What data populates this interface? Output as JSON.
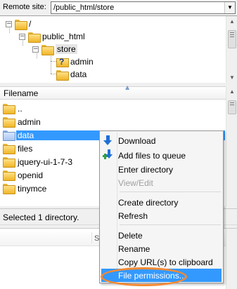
{
  "site_bar": {
    "label": "Remote site:",
    "path": "/public_html/store",
    "dropdown_icon": "chevron-down-icon"
  },
  "tree": {
    "nodes": [
      {
        "label": "/",
        "expander": "−"
      },
      {
        "label": "public_html",
        "expander": "−"
      },
      {
        "label": "store",
        "expander": "−"
      },
      {
        "label": "admin"
      },
      {
        "label": "data"
      }
    ]
  },
  "file_list": {
    "column_header": "Filename",
    "items": [
      {
        "name": ".."
      },
      {
        "name": "admin"
      },
      {
        "name": "data"
      },
      {
        "name": "files"
      },
      {
        "name": "jquery-ui-1-7-3"
      },
      {
        "name": "openid"
      },
      {
        "name": "tinymce"
      }
    ],
    "selected_index": 2
  },
  "status": {
    "text": "Selected 1 directory."
  },
  "queue": {
    "header_fragment": "S"
  },
  "context_menu": {
    "items": [
      {
        "label": "Download",
        "icon": "download-icon"
      },
      {
        "label": "Add files to queue",
        "icon": "add-to-queue-icon"
      },
      {
        "label": "Enter directory"
      },
      {
        "label": "View/Edit",
        "disabled": true
      },
      {
        "label": "Create directory"
      },
      {
        "label": "Refresh"
      },
      {
        "label": "Delete"
      },
      {
        "label": "Rename"
      },
      {
        "label": "Copy URL(s) to clipboard"
      },
      {
        "label": "File permissions...",
        "highlighted": true
      }
    ]
  },
  "colors": {
    "selection": "#3399ff",
    "highlight_ring": "#f58a32",
    "folder": "#f0b528"
  }
}
